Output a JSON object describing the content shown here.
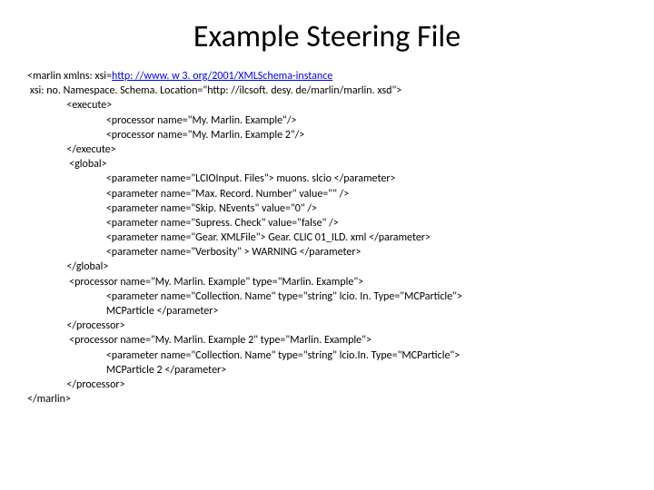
{
  "title": "Example Steering File",
  "lines": {
    "l1a": "<marlin xmlns: xsi=",
    "l1b": "http: //www. w 3. org/2001/XMLSchema-instance",
    "l2": " xsi: no. Namespace. Schema. Location=\"http: //ilcsoft. desy. de/marlin/marlin. xsd\">",
    "l3": "                <execute>",
    "l4": "                                <processor name=\"My. Marlin. Example\"/>",
    "l5": "                                <processor name=\"My. Marlin. Example 2\"/>",
    "l6": "                </execute>",
    "l7": "                 <global>",
    "l8": "                                <parameter name=\"LCIOInput. Files\"> muons. slcio </parameter>",
    "l9": "                                <parameter name=\"Max. Record. Number\" value=\"\" />",
    "l10": "                                <parameter name=\"Skip. NEvents\" value=\"0\" />",
    "l11": "                                <parameter name=\"Supress. Check\" value=\"false\" />",
    "l12": "                                <parameter name=\"Gear. XMLFile\"> Gear. CLIC 01_ILD. xml </parameter>",
    "l13": "                                <parameter name=\"Verbosity\" > WARNING </parameter>",
    "l14": "                </global>",
    "l15": "                 <processor name=\"My. Marlin. Example\" type=\"Marlin. Example\">",
    "l16": "                                <parameter name=\"Collection. Name\" type=\"string\" lcio. In. Type=\"MCParticle\">",
    "l17": "                                MCParticle </parameter>",
    "l18": "                </processor>",
    "l19": "                 <processor name=\"My. Marlin. Example 2\" type=\"Marlin. Example\">",
    "l20": "                                <parameter name=\"Collection. Name\" type=\"string\" lcio.In. Type=\"MCParticle\">",
    "l21": "                                MCParticle 2 </parameter>",
    "l22": "                </processor>",
    "l23": "</marlin>"
  }
}
